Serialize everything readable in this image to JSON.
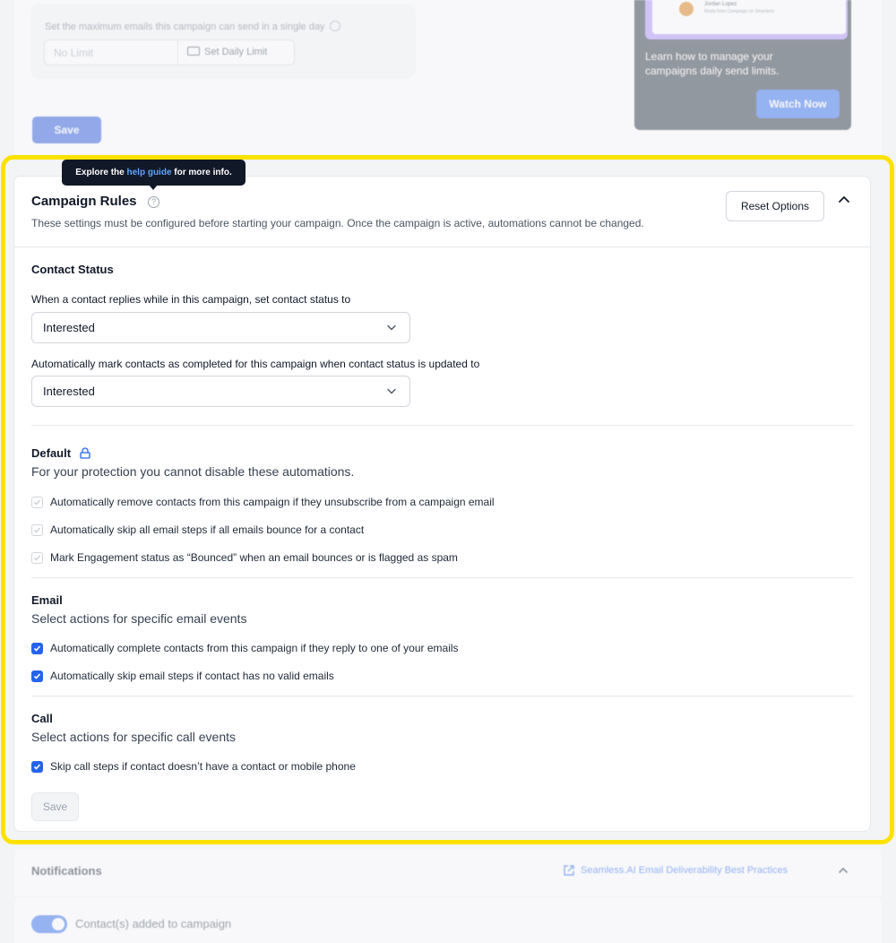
{
  "daily_limit": {
    "label": "Set the maximum emails this campaign can send in a single day",
    "input_value": "No Limit",
    "button_label": "Set Daily Limit",
    "save_label": "Save"
  },
  "promo": {
    "preview_name": "Jordan Lopez",
    "preview_sub": "Reply from Campaign on Seamless",
    "text": "Learn how to manage your campaigns daily send limits.",
    "button_label": "Watch Now"
  },
  "tooltip": {
    "prefix": "Explore the ",
    "link": "help guide",
    "suffix": " for more info."
  },
  "campaign_rules": {
    "title": "Campaign Rules",
    "description": "These settings must be configured before starting your campaign. Once the campaign is active, automations cannot be changed.",
    "reset_label": "Reset Options",
    "contact_status": {
      "title": "Contact Status",
      "reply_label": "When a contact replies while in this campaign, set contact status to",
      "reply_value": "Interested",
      "complete_label": "Automatically mark contacts as completed for this campaign when contact status is updated to",
      "complete_value": "Interested"
    },
    "default": {
      "title": "Default",
      "subtitle": "For your protection you cannot disable these automations.",
      "items": [
        "Automatically remove contacts from this campaign if they unsubscribe from a campaign email",
        "Automatically skip all email steps if all emails bounce for a contact",
        "Mark Engagement status as “Bounced” when an email bounces or is flagged as spam"
      ]
    },
    "email": {
      "title": "Email",
      "subtitle": "Select actions for specific email events",
      "items": [
        "Automatically complete contacts from this campaign if they reply to one of your emails",
        "Automatically skip email steps if contact has no valid emails"
      ]
    },
    "call": {
      "title": "Call",
      "subtitle": "Select actions for specific call events",
      "items": [
        "Skip call steps if contact doesn’t have a contact or mobile phone"
      ]
    },
    "save_label": "Save"
  },
  "notifications": {
    "title": "Notifications",
    "link": "Seamless.AI Email Deliverability Best Practices",
    "toggle_label": "Contact(s) added to campaign",
    "toggle_on": true
  },
  "colors": {
    "accent": "#2563eb",
    "highlight": "#fde200",
    "tooltip_bg": "#111827"
  }
}
